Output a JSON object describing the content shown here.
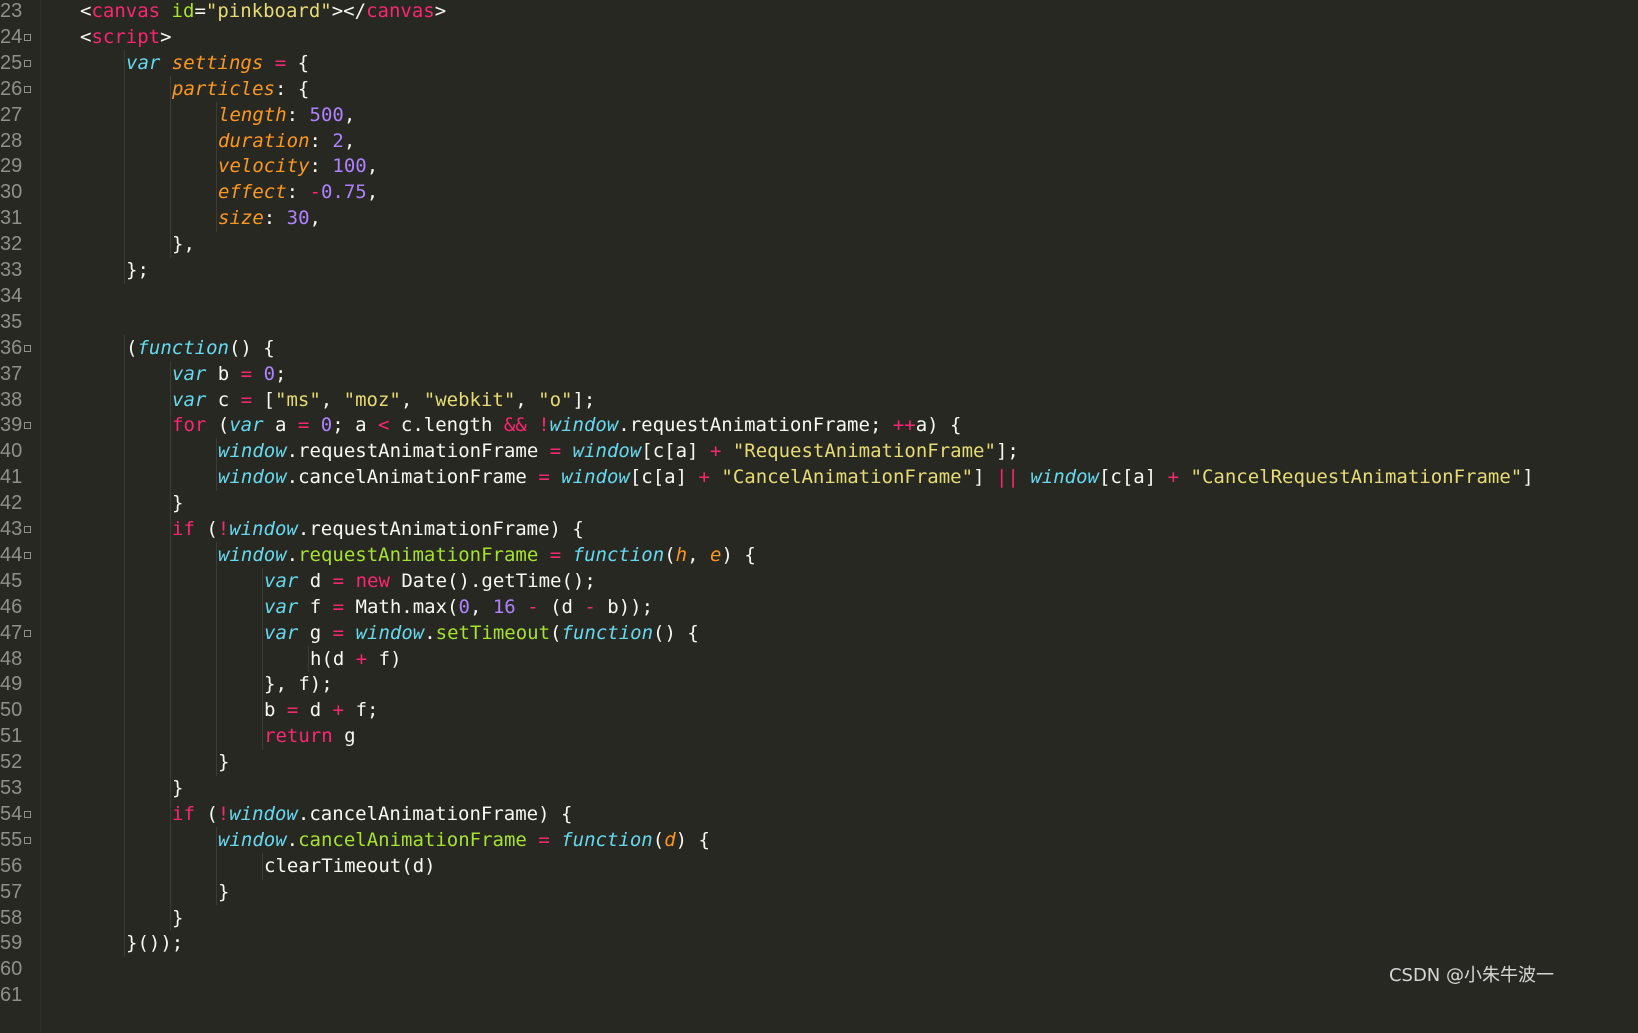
{
  "editor": {
    "watermark": "CSDN @小朱牛波一",
    "colors": {
      "background": "#272822",
      "keyword": "#f92672",
      "storage": "#66d9ef",
      "property": "#fd971f",
      "number": "#ae81ff",
      "string": "#e6db74",
      "function": "#a6e22e",
      "text": "#f8f8f2",
      "line_number": "#8f908a"
    },
    "lines": [
      {
        "num": "23",
        "fold": false,
        "indent": 1,
        "tokens": [
          [
            "txt",
            "<"
          ],
          [
            "tag",
            "canvas"
          ],
          [
            "txt",
            " "
          ],
          [
            "attr",
            "id"
          ],
          [
            "txt",
            "="
          ],
          [
            "str",
            "\"pinkboard\""
          ],
          [
            "txt",
            "></"
          ],
          [
            "tag",
            "canvas"
          ],
          [
            "txt",
            ">"
          ]
        ]
      },
      {
        "num": "24",
        "fold": true,
        "indent": 1,
        "tokens": [
          [
            "txt",
            "<"
          ],
          [
            "tag",
            "script"
          ],
          [
            "txt",
            ">"
          ]
        ]
      },
      {
        "num": "25",
        "fold": true,
        "indent": 2,
        "tokens": [
          [
            "st",
            "var"
          ],
          [
            "txt",
            " "
          ],
          [
            "prop",
            "settings"
          ],
          [
            "txt",
            " "
          ],
          [
            "kw",
            "="
          ],
          [
            "txt",
            " {"
          ]
        ]
      },
      {
        "num": "26",
        "fold": true,
        "indent": 3,
        "tokens": [
          [
            "prop",
            "particles"
          ],
          [
            "txt",
            ": {"
          ]
        ]
      },
      {
        "num": "27",
        "fold": false,
        "indent": 4,
        "tokens": [
          [
            "prop",
            "length"
          ],
          [
            "txt",
            ": "
          ],
          [
            "num",
            "500"
          ],
          [
            "txt",
            ","
          ]
        ]
      },
      {
        "num": "28",
        "fold": false,
        "indent": 4,
        "tokens": [
          [
            "prop",
            "duration"
          ],
          [
            "txt",
            ": "
          ],
          [
            "num",
            "2"
          ],
          [
            "txt",
            ","
          ]
        ]
      },
      {
        "num": "29",
        "fold": false,
        "indent": 4,
        "tokens": [
          [
            "prop",
            "velocity"
          ],
          [
            "txt",
            ": "
          ],
          [
            "num",
            "100"
          ],
          [
            "txt",
            ","
          ]
        ]
      },
      {
        "num": "30",
        "fold": false,
        "indent": 4,
        "tokens": [
          [
            "prop",
            "effect"
          ],
          [
            "txt",
            ": "
          ],
          [
            "kw",
            "-"
          ],
          [
            "num",
            "0.75"
          ],
          [
            "txt",
            ","
          ]
        ]
      },
      {
        "num": "31",
        "fold": false,
        "indent": 4,
        "tokens": [
          [
            "prop",
            "size"
          ],
          [
            "txt",
            ": "
          ],
          [
            "num",
            "30"
          ],
          [
            "txt",
            ","
          ]
        ]
      },
      {
        "num": "32",
        "fold": false,
        "indent": 3,
        "tokens": [
          [
            "txt",
            "},"
          ]
        ]
      },
      {
        "num": "33",
        "fold": false,
        "indent": 2,
        "tokens": [
          [
            "txt",
            "};"
          ]
        ]
      },
      {
        "num": "34",
        "fold": false,
        "indent": 0,
        "tokens": []
      },
      {
        "num": "35",
        "fold": false,
        "indent": 0,
        "tokens": []
      },
      {
        "num": "36",
        "fold": true,
        "indent": 2,
        "tokens": [
          [
            "txt",
            "("
          ],
          [
            "st",
            "function"
          ],
          [
            "txt",
            "() {"
          ]
        ]
      },
      {
        "num": "37",
        "fold": false,
        "indent": 3,
        "tokens": [
          [
            "st",
            "var"
          ],
          [
            "txt",
            " b "
          ],
          [
            "kw",
            "="
          ],
          [
            "txt",
            " "
          ],
          [
            "num",
            "0"
          ],
          [
            "txt",
            ";"
          ]
        ]
      },
      {
        "num": "38",
        "fold": false,
        "indent": 3,
        "tokens": [
          [
            "st",
            "var"
          ],
          [
            "txt",
            " c "
          ],
          [
            "kw",
            "="
          ],
          [
            "txt",
            " ["
          ],
          [
            "str",
            "\"ms\""
          ],
          [
            "txt",
            ", "
          ],
          [
            "str",
            "\"moz\""
          ],
          [
            "txt",
            ", "
          ],
          [
            "str",
            "\"webkit\""
          ],
          [
            "txt",
            ", "
          ],
          [
            "str",
            "\"o\""
          ],
          [
            "txt",
            "];"
          ]
        ]
      },
      {
        "num": "39",
        "fold": true,
        "indent": 3,
        "tokens": [
          [
            "kw",
            "for"
          ],
          [
            "txt",
            " ("
          ],
          [
            "st",
            "var"
          ],
          [
            "txt",
            " a "
          ],
          [
            "kw",
            "="
          ],
          [
            "txt",
            " "
          ],
          [
            "num",
            "0"
          ],
          [
            "txt",
            "; a "
          ],
          [
            "kw",
            "<"
          ],
          [
            "txt",
            " c.length "
          ],
          [
            "kw",
            "&&"
          ],
          [
            "txt",
            " "
          ],
          [
            "kw",
            "!"
          ],
          [
            "st",
            "window"
          ],
          [
            "txt",
            ".requestAnimationFrame; "
          ],
          [
            "kw",
            "++"
          ],
          [
            "txt",
            "a) {"
          ]
        ]
      },
      {
        "num": "40",
        "fold": false,
        "indent": 4,
        "tokens": [
          [
            "st",
            "window"
          ],
          [
            "txt",
            ".requestAnimationFrame "
          ],
          [
            "kw",
            "="
          ],
          [
            "txt",
            " "
          ],
          [
            "st",
            "window"
          ],
          [
            "txt",
            "[c[a] "
          ],
          [
            "kw",
            "+"
          ],
          [
            "txt",
            " "
          ],
          [
            "str",
            "\"RequestAnimationFrame\""
          ],
          [
            "txt",
            "];"
          ]
        ]
      },
      {
        "num": "41",
        "fold": false,
        "indent": 4,
        "tokens": [
          [
            "st",
            "window"
          ],
          [
            "txt",
            ".cancelAnimationFrame "
          ],
          [
            "kw",
            "="
          ],
          [
            "txt",
            " "
          ],
          [
            "st",
            "window"
          ],
          [
            "txt",
            "[c[a] "
          ],
          [
            "kw",
            "+"
          ],
          [
            "txt",
            " "
          ],
          [
            "str",
            "\"CancelAnimationFrame\""
          ],
          [
            "txt",
            "] "
          ],
          [
            "kw",
            "||"
          ],
          [
            "txt",
            " "
          ],
          [
            "st",
            "window"
          ],
          [
            "txt",
            "[c[a] "
          ],
          [
            "kw",
            "+"
          ],
          [
            "txt",
            " "
          ],
          [
            "str",
            "\"CancelRequestAnimationFrame\""
          ],
          [
            "txt",
            "]"
          ]
        ]
      },
      {
        "num": "42",
        "fold": false,
        "indent": 3,
        "tokens": [
          [
            "txt",
            "}"
          ]
        ]
      },
      {
        "num": "43",
        "fold": true,
        "indent": 3,
        "tokens": [
          [
            "kw",
            "if"
          ],
          [
            "txt",
            " ("
          ],
          [
            "kw",
            "!"
          ],
          [
            "st",
            "window"
          ],
          [
            "txt",
            ".requestAnimationFrame) {"
          ]
        ]
      },
      {
        "num": "44",
        "fold": true,
        "indent": 4,
        "tokens": [
          [
            "st",
            "window"
          ],
          [
            "txt",
            "."
          ],
          [
            "fn",
            "requestAnimationFrame"
          ],
          [
            "txt",
            " "
          ],
          [
            "kw",
            "="
          ],
          [
            "txt",
            " "
          ],
          [
            "st",
            "function"
          ],
          [
            "txt",
            "("
          ],
          [
            "param",
            "h"
          ],
          [
            "txt",
            ", "
          ],
          [
            "param",
            "e"
          ],
          [
            "txt",
            ") {"
          ]
        ]
      },
      {
        "num": "45",
        "fold": false,
        "indent": 5,
        "tokens": [
          [
            "st",
            "var"
          ],
          [
            "txt",
            " d "
          ],
          [
            "kw",
            "="
          ],
          [
            "txt",
            " "
          ],
          [
            "kw",
            "new"
          ],
          [
            "txt",
            " Date().getTime();"
          ]
        ]
      },
      {
        "num": "46",
        "fold": false,
        "indent": 5,
        "tokens": [
          [
            "st",
            "var"
          ],
          [
            "txt",
            " f "
          ],
          [
            "kw",
            "="
          ],
          [
            "txt",
            " Math.max("
          ],
          [
            "num",
            "0"
          ],
          [
            "txt",
            ", "
          ],
          [
            "num",
            "16"
          ],
          [
            "txt",
            " "
          ],
          [
            "kw",
            "-"
          ],
          [
            "txt",
            " (d "
          ],
          [
            "kw",
            "-"
          ],
          [
            "txt",
            " b));"
          ]
        ]
      },
      {
        "num": "47",
        "fold": true,
        "indent": 5,
        "tokens": [
          [
            "st",
            "var"
          ],
          [
            "txt",
            " g "
          ],
          [
            "kw",
            "="
          ],
          [
            "txt",
            " "
          ],
          [
            "st",
            "window"
          ],
          [
            "txt",
            "."
          ],
          [
            "fn",
            "setTimeout"
          ],
          [
            "txt",
            "("
          ],
          [
            "st",
            "function"
          ],
          [
            "txt",
            "() {"
          ]
        ]
      },
      {
        "num": "48",
        "fold": false,
        "indent": 6,
        "tokens": [
          [
            "txt",
            "h(d "
          ],
          [
            "kw",
            "+"
          ],
          [
            "txt",
            " f)"
          ]
        ]
      },
      {
        "num": "49",
        "fold": false,
        "indent": 5,
        "tokens": [
          [
            "txt",
            "}, f);"
          ]
        ]
      },
      {
        "num": "50",
        "fold": false,
        "indent": 5,
        "tokens": [
          [
            "txt",
            "b "
          ],
          [
            "kw",
            "="
          ],
          [
            "txt",
            " d "
          ],
          [
            "kw",
            "+"
          ],
          [
            "txt",
            " f;"
          ]
        ]
      },
      {
        "num": "51",
        "fold": false,
        "indent": 5,
        "tokens": [
          [
            "kw",
            "return"
          ],
          [
            "txt",
            " g"
          ]
        ]
      },
      {
        "num": "52",
        "fold": false,
        "indent": 4,
        "tokens": [
          [
            "txt",
            "}"
          ]
        ]
      },
      {
        "num": "53",
        "fold": false,
        "indent": 3,
        "tokens": [
          [
            "txt",
            "}"
          ]
        ]
      },
      {
        "num": "54",
        "fold": true,
        "indent": 3,
        "tokens": [
          [
            "kw",
            "if"
          ],
          [
            "txt",
            " ("
          ],
          [
            "kw",
            "!"
          ],
          [
            "st",
            "window"
          ],
          [
            "txt",
            ".cancelAnimationFrame) {"
          ]
        ]
      },
      {
        "num": "55",
        "fold": true,
        "indent": 4,
        "tokens": [
          [
            "st",
            "window"
          ],
          [
            "txt",
            "."
          ],
          [
            "fn",
            "cancelAnimationFrame"
          ],
          [
            "txt",
            " "
          ],
          [
            "kw",
            "="
          ],
          [
            "txt",
            " "
          ],
          [
            "st",
            "function"
          ],
          [
            "txt",
            "("
          ],
          [
            "param",
            "d"
          ],
          [
            "txt",
            ") {"
          ]
        ]
      },
      {
        "num": "56",
        "fold": false,
        "indent": 5,
        "tokens": [
          [
            "txt",
            "clearTimeout(d)"
          ]
        ]
      },
      {
        "num": "57",
        "fold": false,
        "indent": 4,
        "tokens": [
          [
            "txt",
            "}"
          ]
        ]
      },
      {
        "num": "58",
        "fold": false,
        "indent": 3,
        "tokens": [
          [
            "txt",
            "}"
          ]
        ]
      },
      {
        "num": "59",
        "fold": false,
        "indent": 2,
        "tokens": [
          [
            "txt",
            "}());"
          ]
        ]
      },
      {
        "num": "60",
        "fold": false,
        "indent": 0,
        "tokens": []
      },
      {
        "num": "61",
        "fold": false,
        "indent": 0,
        "tokens": []
      }
    ]
  }
}
